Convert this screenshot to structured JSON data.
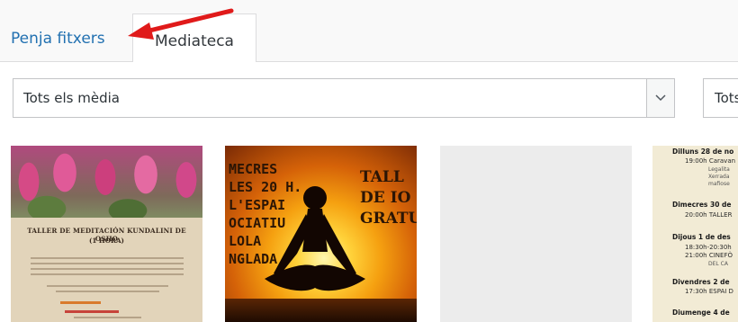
{
  "tabs": {
    "upload_label": "Penja fitxers",
    "library_label": "Mediateca"
  },
  "filters": {
    "media_type_value": "Tots els mèdia",
    "date_value": "Tots"
  },
  "colors": {
    "link": "#2271b1",
    "annotation_arrow": "#e01a1a"
  },
  "media": {
    "item1": {
      "title_line1": "TALLER DE MEDITACIÓN KUNDALINI DE OSHO",
      "title_line2": "(1 HORA)"
    },
    "item2": {
      "left_lines": [
        "MECRES",
        "LES 20 H.",
        "L'ESPAI",
        "OCIATIU",
        "LOLA",
        "NGLADA"
      ],
      "right_lines": [
        "TALL",
        "DE IO",
        "GRATU"
      ]
    },
    "item4": {
      "lines": [
        "Dilluns 28 de no",
        "19:00h Caravan",
        "Legalita",
        "Xerrada",
        "mafiose",
        "Dimecres 30 de",
        "20:00h TALLER",
        "Dijous 1 de des",
        "18:30h-20:30h",
        "21:00h CINEFÒ",
        "DEL CA",
        "Divendres 2 de",
        "17:30h ESPAI D",
        "Diumenge 4 de"
      ]
    }
  }
}
